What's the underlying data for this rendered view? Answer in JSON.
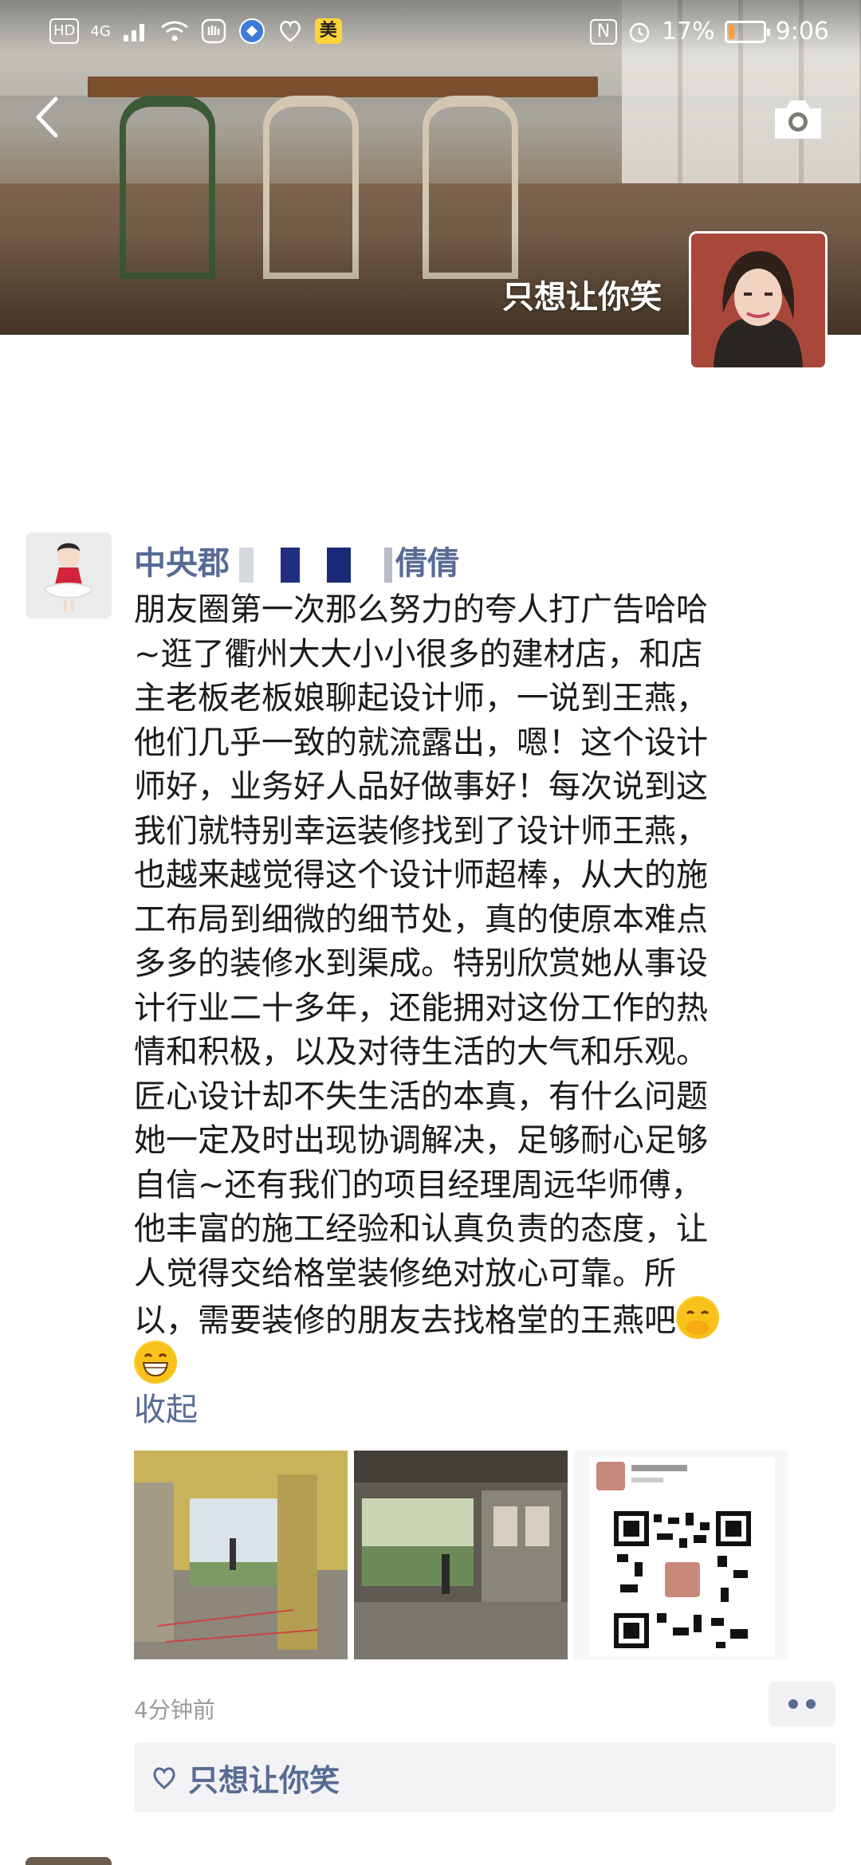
{
  "status_bar": {
    "hd": "HD",
    "network": "4G",
    "app_badge": "美",
    "nfc": "N",
    "battery": "17%",
    "time": "9:06",
    "battery_level": 0.17,
    "battery_color": "#ff9f2e"
  },
  "cover": {
    "user_name": "只想让你笑"
  },
  "post": {
    "author_prefix": "中央郡",
    "author_suffix": "倩倩",
    "lines": [
      "朋友圈第一次那么努力的夸人打广告哈哈",
      "~逛了衢州大大小小很多的建材店，和店",
      "主老板老板娘聊起设计师，一说到王燕，",
      "他们几乎一致的就流露出，嗯！这个设计",
      "师好，业务好人品好做事好！每次说到这",
      "我们就特别幸运装修找到了设计师王燕，",
      "也越来越觉得这个设计师超棒，从大的施",
      "工布局到细微的细节处，真的使原本难点",
      "多多的装修水到渠成。特别欣赏她从事设",
      "计行业二十多年，还能拥对这份工作的热",
      "情和积极，以及对待生活的大气和乐观。",
      "匠心设计却不失生活的本真，有什么问题",
      "她一定及时出现协调解决，足够耐心足够",
      "自信~还有我们的项目经理周远华师傅，",
      "他丰富的施工经验和认真负责的态度，让",
      "人觉得交给格堂装修绝对放心可靠。所",
      "以，需要装修的朋友去找格堂的王燕吧"
    ],
    "collapse_label": "收起",
    "time_ago": "4分钟前",
    "like_user": "只想让你笑"
  },
  "icons": {
    "back": "chevron-left-icon",
    "camera": "camera-icon",
    "like": "heart-icon",
    "more": "more-dots-icon"
  },
  "colors": {
    "link": "#576b95",
    "like_bg": "#f3f3f5"
  }
}
